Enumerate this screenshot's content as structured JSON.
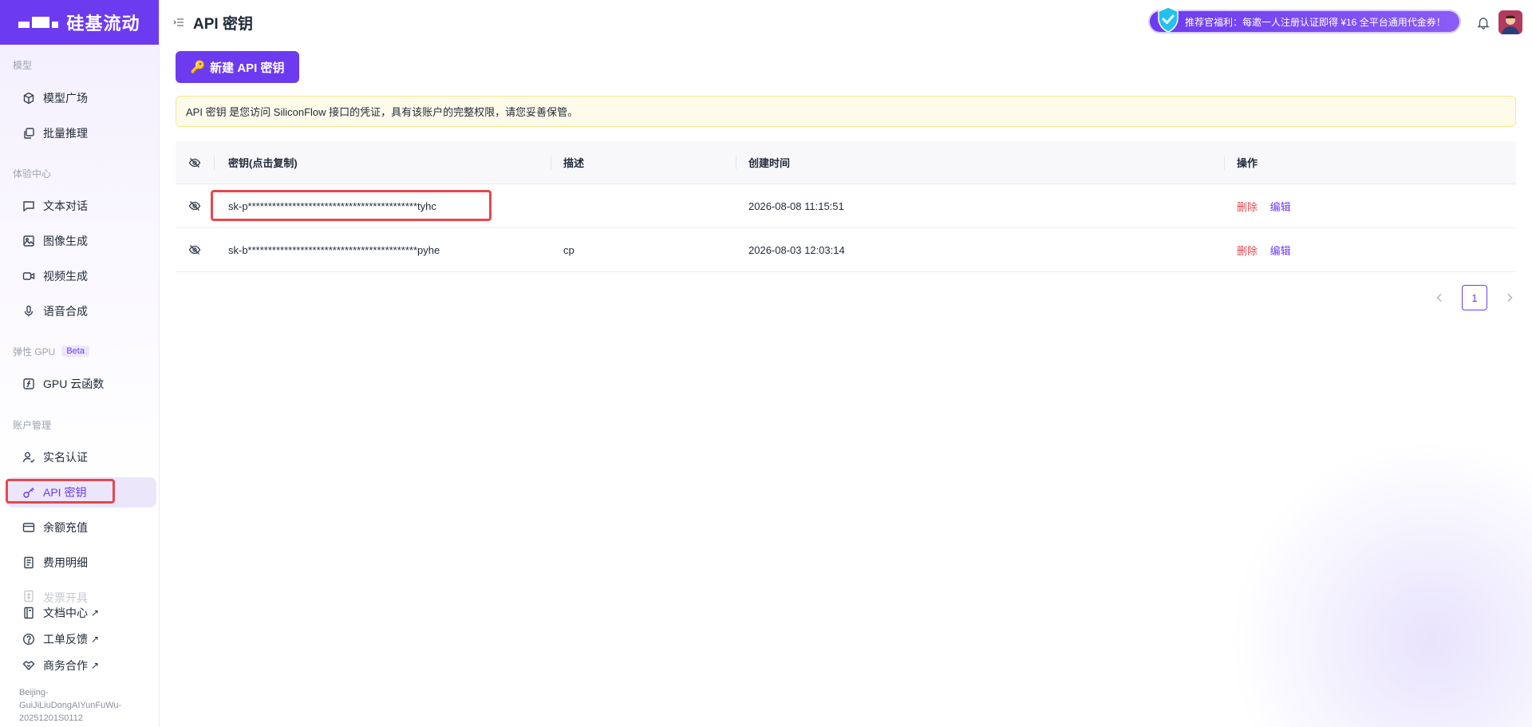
{
  "brand": {
    "name": "硅基流动"
  },
  "sidebar": {
    "groups": [
      {
        "title": "模型",
        "items": [
          {
            "label": "模型广场",
            "icon": "cube-icon"
          },
          {
            "label": "批量推理",
            "icon": "layers-icon"
          }
        ]
      },
      {
        "title": "体验中心",
        "items": [
          {
            "label": "文本对话",
            "icon": "chat-icon"
          },
          {
            "label": "图像生成",
            "icon": "image-icon"
          },
          {
            "label": "视频生成",
            "icon": "video-icon"
          },
          {
            "label": "语音合成",
            "icon": "mic-icon"
          }
        ]
      },
      {
        "title": "弹性 GPU",
        "badge": "Beta",
        "items": [
          {
            "label": "GPU 云函数",
            "icon": "function-icon"
          }
        ]
      },
      {
        "title": "账户管理",
        "items": [
          {
            "label": "实名认证",
            "icon": "user-check-icon"
          },
          {
            "label": "API 密钥",
            "icon": "key-icon",
            "active": true
          },
          {
            "label": "余额充值",
            "icon": "card-icon"
          },
          {
            "label": "费用明细",
            "icon": "receipt-icon"
          },
          {
            "label": "发票开具",
            "icon": "invoice-icon",
            "faded": true
          }
        ]
      }
    ],
    "footer_links": [
      {
        "label": "文档中心",
        "icon": "book-icon",
        "ext": "↗"
      },
      {
        "label": "工单反馈",
        "icon": "question-icon",
        "ext": "↗"
      },
      {
        "label": "商务合作",
        "icon": "handshake-icon",
        "ext": "↗"
      }
    ],
    "version": "Beijing-GuiJiLiuDongAIYunFuWu-20251201S0112"
  },
  "header": {
    "title": "API 密钥",
    "promo": "推荐官福利：每邀一人注册认证即得 ¥16 全平台通用代金券！"
  },
  "main": {
    "new_key_button": "新建 API 密钥",
    "notice": "API 密钥 是您访问 SiliconFlow 接口的凭证，具有该账户的完整权限，请您妥善保管。",
    "table": {
      "columns": [
        "密钥(点击复制)",
        "描述",
        "创建时间",
        "操作"
      ],
      "rows": [
        {
          "key": "sk-p******************************************tyhc",
          "desc": "",
          "created": "2026-08-08 11:15:51",
          "delete": "删除",
          "edit": "编辑"
        },
        {
          "key": "sk-b******************************************pyhe",
          "desc": "cp",
          "created": "2026-08-03 12:03:14",
          "delete": "删除",
          "edit": "编辑"
        }
      ]
    },
    "pagination": {
      "current": "1"
    }
  },
  "colors": {
    "accent": "#6d3bef",
    "danger": "#e5484d",
    "notice_bg": "#fffbeb"
  }
}
